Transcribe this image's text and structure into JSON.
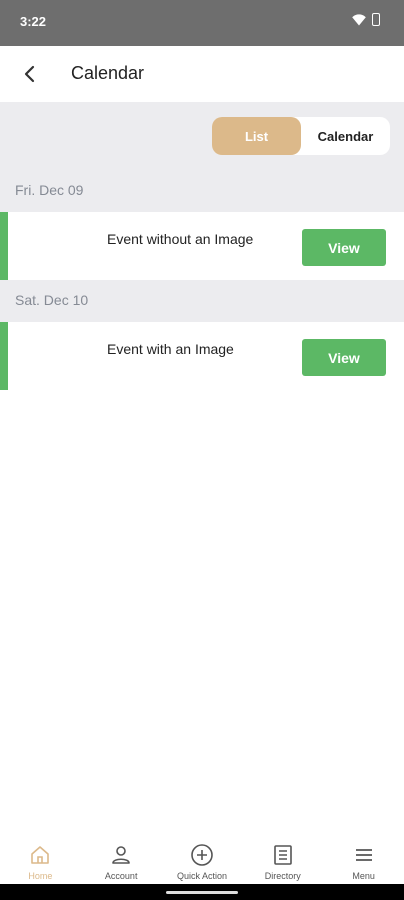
{
  "status_bar": {
    "time": "3:22"
  },
  "header": {
    "title": "Calendar"
  },
  "toggle": {
    "list_label": "List",
    "calendar_label": "Calendar"
  },
  "days": [
    {
      "date": "Fri. Dec 09",
      "event_title": "Event without an Image",
      "button": "View"
    },
    {
      "date": "Sat. Dec 10",
      "event_title": "Event with an Image",
      "button": "View"
    }
  ],
  "nav": [
    {
      "label": "Home",
      "icon": "home-icon"
    },
    {
      "label": "Account",
      "icon": "account-icon"
    },
    {
      "label": "Quick Action",
      "icon": "plus-circle-icon"
    },
    {
      "label": "Directory",
      "icon": "directory-icon"
    },
    {
      "label": "Menu",
      "icon": "menu-icon"
    }
  ],
  "colors": {
    "accent": "#dcb98a",
    "event_green": "#5cb865",
    "section_bg": "#ececef"
  }
}
